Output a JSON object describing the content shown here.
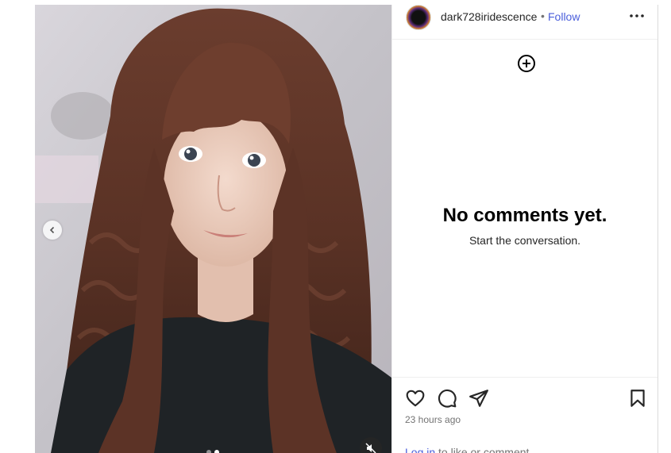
{
  "post": {
    "username": "dark728iridescence",
    "separator": "•",
    "follow_label": "Follow",
    "carousel": {
      "slide_count": 2,
      "active_slide": 2
    }
  },
  "comments": {
    "empty_title": "No comments yet.",
    "empty_subtitle": "Start the conversation."
  },
  "meta": {
    "timestamp": "23 hours ago",
    "login_link": "Log in",
    "login_rest": " to like or comment."
  },
  "icons": {
    "more": "more-options-icon",
    "add": "add-comment-icon",
    "like": "heart-icon",
    "comment": "comment-bubble-icon",
    "share": "paper-plane-icon",
    "save": "bookmark-icon",
    "prev": "chevron-left-icon",
    "mute": "speaker-muted-icon"
  },
  "colors": {
    "link": "#4a5edb",
    "text": "#262626",
    "muted": "#737373"
  }
}
